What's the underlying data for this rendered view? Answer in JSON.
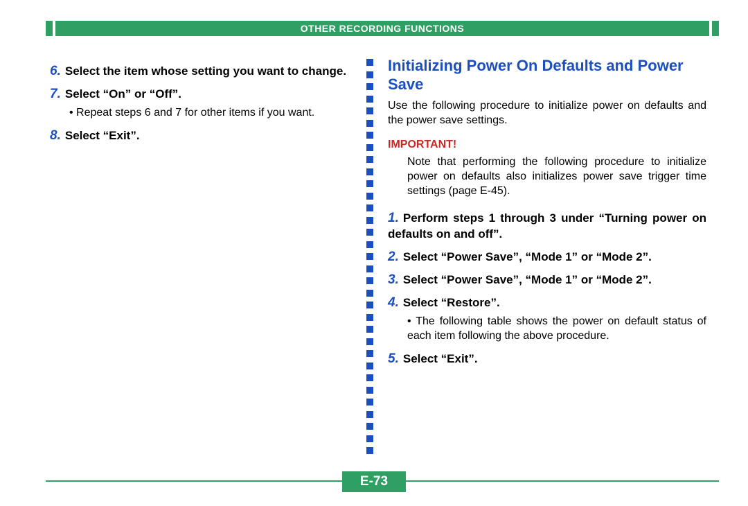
{
  "header": {
    "title": "OTHER RECORDING FUNCTIONS"
  },
  "left": {
    "step6_num": "6.",
    "step6_text": "Select the item whose setting you want to change.",
    "step7_num": "7.",
    "step7_text": "Select “On” or “Off”.",
    "step7_sub": "Repeat steps 6 and 7 for other items if you want.",
    "step8_num": "8.",
    "step8_text": "Select “Exit”."
  },
  "right": {
    "section_title": "Initializing Power On Defaults and Power Save",
    "intro": "Use the following procedure to initialize power on defaults and the power save settings.",
    "important_label": "IMPORTANT!",
    "important_body": "Note that performing the following procedure to initialize power on defaults also initializes power save trigger time settings (page E-45).",
    "step1_num": "1.",
    "step1_text": "Perform steps 1 through 3 under “Turning power on defaults on and off”.",
    "step2_num": "2.",
    "step2_text": "Select “Power Save”, “Mode 1” or “Mode 2”.",
    "step3_num": "3.",
    "step3_text": "Select “Power Save”, “Mode 1” or “Mode 2”.",
    "step4_num": "4.",
    "step4_text": "Select “Restore”.",
    "step4_sub": "The following table shows the power on default status of each item following the above procedure.",
    "step5_num": "5.",
    "step5_text": "Select “Exit”."
  },
  "page_number": "E-73"
}
